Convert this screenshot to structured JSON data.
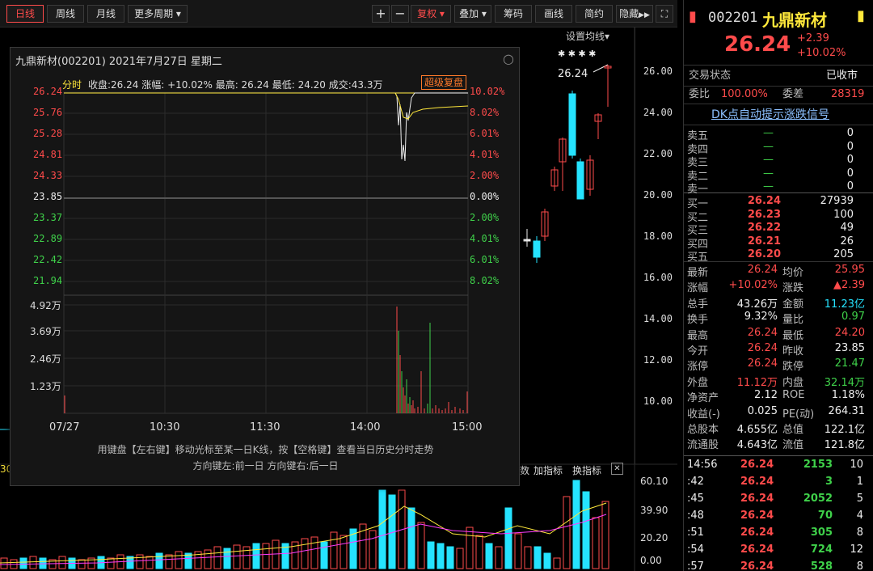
{
  "toolbar": {
    "periods": [
      "日线",
      "周线",
      "月线",
      "更多周期"
    ],
    "more_caret": "▾",
    "plus": "+",
    "minus": "−",
    "fuquan": "复权",
    "diejia": "叠加",
    "chouma": "筹码",
    "huaxian": "画线",
    "jianyue": "简约",
    "yincang": "隐藏",
    "fullscreen_icon": "⛶",
    "ma_setting": "设置均线"
  },
  "main_chart": {
    "price_ticks": [
      "26.00",
      "24.00",
      "22.00",
      "20.00",
      "18.00",
      "16.00",
      "14.00",
      "12.00",
      "10.00"
    ],
    "last_price_label": "26.24",
    "volume_ticks": [
      "60.10",
      "39.90",
      "20.20",
      "0.00"
    ],
    "indicator_menu": [
      "数",
      "加指标",
      "换指标"
    ],
    "close_x": "✕",
    "vol_label": "30"
  },
  "popup": {
    "title": "九鼎新材(002201) 2021年7月27日 星期二",
    "close": "○",
    "info_prefix": "分时",
    "info": "收盘:26.24 涨幅: +10.02% 最高: 26.24 最低: 24.20 成交:43.3万",
    "super_replay": "超级复盘",
    "price_left": [
      "26.24",
      "25.76",
      "25.28",
      "24.81",
      "24.33",
      "23.85",
      "23.37",
      "22.89",
      "22.42",
      "21.94"
    ],
    "pct_right": [
      "10.02%",
      "8.02%",
      "6.01%",
      "4.01%",
      "2.00%",
      "0.00%",
      "2.00%",
      "4.01%",
      "6.01%",
      "8.02%"
    ],
    "vol_left": [
      "4.92万",
      "3.69万",
      "2.46万",
      "1.23万"
    ],
    "time_labels": [
      "07/27",
      "10:30",
      "11:30",
      "14:00",
      "15:00"
    ],
    "hint1": "用键盘【左右键】移动光标至某一日K线，按【空格键】查看当日历史分时走势",
    "hint2": "方向键左:前一日  方向键右:后一日"
  },
  "quote": {
    "code": "002201",
    "name": "九鼎新材",
    "price": "26.24",
    "change": "+2.39",
    "pct": "+10.02%",
    "status_label": "交易状态",
    "status_value": "已收市",
    "weibi_label": "委比",
    "weibi_value": "100.00%",
    "weicha_label": "委差",
    "weicha_value": "28319",
    "dk_link": "DK点自动提示涨跌信号",
    "asks": [
      {
        "label": "卖五",
        "price": "—",
        "vol": "0"
      },
      {
        "label": "卖四",
        "price": "—",
        "vol": "0"
      },
      {
        "label": "卖三",
        "price": "—",
        "vol": "0"
      },
      {
        "label": "卖二",
        "price": "—",
        "vol": "0"
      },
      {
        "label": "卖一",
        "price": "—",
        "vol": "0"
      }
    ],
    "bids": [
      {
        "label": "买一",
        "price": "26.24",
        "vol": "27939"
      },
      {
        "label": "买二",
        "price": "26.23",
        "vol": "100"
      },
      {
        "label": "买三",
        "price": "26.22",
        "vol": "49"
      },
      {
        "label": "买四",
        "price": "26.21",
        "vol": "26"
      },
      {
        "label": "买五",
        "price": "26.20",
        "vol": "205"
      }
    ],
    "stats": [
      {
        "l1": "最新",
        "v1": "26.24",
        "c1": "red",
        "l2": "均价",
        "v2": "25.95",
        "c2": "red"
      },
      {
        "l1": "涨幅",
        "v1": "+10.02%",
        "c1": "red",
        "l2": "涨跌",
        "v2": "▲2.39",
        "c2": "red"
      },
      {
        "l1": "总手",
        "v1": "43.26万",
        "c1": "white",
        "l2": "金额",
        "v2": "11.23亿",
        "c2": "cyan"
      },
      {
        "l1": "换手",
        "v1": "9.32%",
        "c1": "white",
        "l2": "量比",
        "v2": "0.97",
        "c2": "green"
      },
      {
        "l1": "最高",
        "v1": "26.24",
        "c1": "red",
        "l2": "最低",
        "v2": "24.20",
        "c2": "red"
      },
      {
        "l1": "今开",
        "v1": "26.24",
        "c1": "red",
        "l2": "昨收",
        "v2": "23.85",
        "c2": "white"
      },
      {
        "l1": "涨停",
        "v1": "26.24",
        "c1": "red",
        "l2": "跌停",
        "v2": "21.47",
        "c2": "green"
      },
      {
        "l1": "外盘",
        "v1": "11.12万",
        "c1": "red",
        "l2": "内盘",
        "v2": "32.14万",
        "c2": "green"
      },
      {
        "l1": "净资产",
        "v1": "2.12",
        "c1": "white",
        "l2": "ROE",
        "v2": "1.18%",
        "c2": "white"
      },
      {
        "l1": "收益(-)",
        "v1": "0.025",
        "c1": "white",
        "l2": "PE(动)",
        "v2": "264.31",
        "c2": "white"
      },
      {
        "l1": "总股本",
        "v1": "4.655亿",
        "c1": "white",
        "l2": "总值",
        "v2": "122.1亿",
        "c2": "white"
      },
      {
        "l1": "流通股",
        "v1": "4.643亿",
        "c1": "white",
        "l2": "流值",
        "v2": "121.8亿",
        "c2": "white"
      }
    ],
    "ticks": [
      {
        "t": "14:56",
        "p": "26.24",
        "v": "2153",
        "n": "10"
      },
      {
        "t": ":42",
        "p": "26.24",
        "v": "3",
        "n": "1"
      },
      {
        "t": ":45",
        "p": "26.24",
        "v": "2052",
        "n": "5"
      },
      {
        "t": ":48",
        "p": "26.24",
        "v": "70",
        "n": "4"
      },
      {
        "t": ":51",
        "p": "26.24",
        "v": "305",
        "n": "8"
      },
      {
        "t": ":54",
        "p": "26.24",
        "v": "724",
        "n": "12"
      },
      {
        "t": ":57",
        "p": "26.24",
        "v": "528",
        "n": "8"
      }
    ]
  },
  "colors": {
    "up": "#ff4b4b",
    "down": "#25e3ff",
    "flat": "#eee",
    "avg": "#ffe83b",
    "ma2": "#ff3cff"
  }
}
